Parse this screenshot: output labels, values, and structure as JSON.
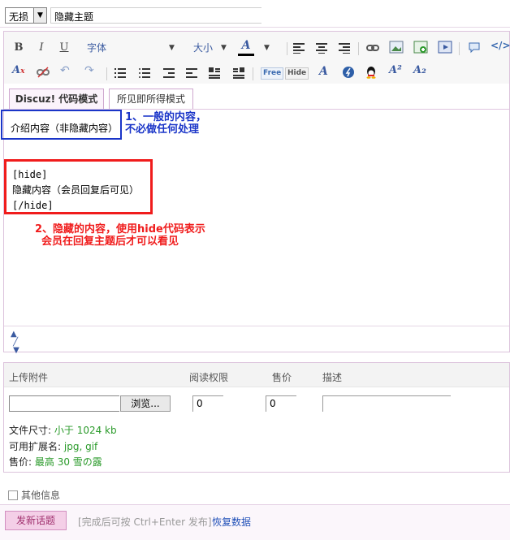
{
  "topbar": {
    "type_select": "无损",
    "title_value": "隐藏主题"
  },
  "toolbar": {
    "bold": "B",
    "italic": "I",
    "underline": "U",
    "font_label": "字体",
    "size_label": "大小",
    "color_letter": "A",
    "free_label": "Free",
    "hide_label": "Hide",
    "sup_label": "A²",
    "sub_label": "A₂"
  },
  "tabs": {
    "code_mode": "Discuz! 代码模式",
    "wysiwyg_mode": "所见即所得模式"
  },
  "content": {
    "intro_text": "介绍内容（非隐藏内容）",
    "hide_open": "[hide]",
    "hide_body": "隐藏内容（会员回复后可见）",
    "hide_close": "[/hide]"
  },
  "annotations": {
    "blue_line1": "1、一般的内容，",
    "blue_line2": "不必做任何处理",
    "red_line1": "2、隐藏的内容，使用hide代码表示",
    "red_line2": "会员在回复主题后才可以看见",
    "blue_color": "#1a35c8",
    "red_color": "#f01c1c"
  },
  "attachments": {
    "col_upload": "上传附件",
    "col_read_perm": "阅读权限",
    "col_price": "售价",
    "col_desc": "描述",
    "browse_label": "浏览...",
    "read_perm_value": "0",
    "price_value": "0",
    "file_size_label": "文件尺寸:",
    "file_size_value": "小于 1024 kb",
    "ext_label": "可用扩展名:",
    "ext_value": "jpg, gif",
    "price_label": "售价:",
    "price_info": "最高 30 雪の露"
  },
  "bottom": {
    "other_info": "其他信息",
    "submit": "发新话题",
    "hint": "[完成后可按 Ctrl+Enter 发布]",
    "restore": "恢复数据"
  }
}
